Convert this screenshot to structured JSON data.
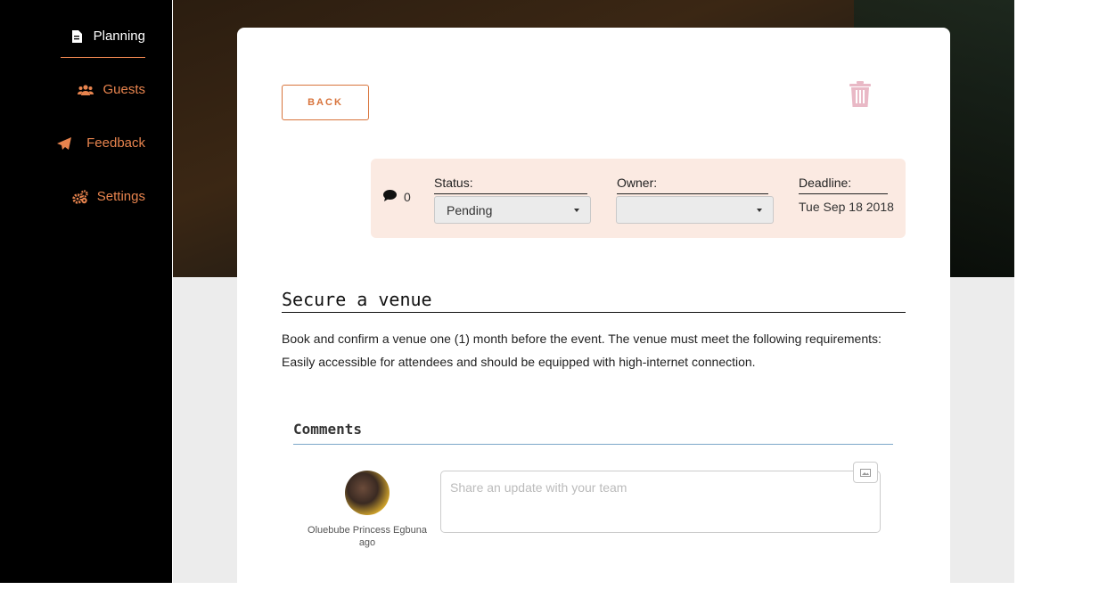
{
  "sidebar": {
    "items": [
      {
        "label": "Planning",
        "icon": "document-icon"
      },
      {
        "label": "Guests",
        "icon": "users-icon"
      },
      {
        "label": "Feedback",
        "icon": "paper-plane-icon"
      },
      {
        "label": "Settings",
        "icon": "gears-icon"
      }
    ],
    "active": "Planning"
  },
  "task": {
    "back_label": "BACK",
    "comment_count": "0",
    "status_label": "Status:",
    "status_value": "Pending",
    "owner_label": "Owner:",
    "owner_value": "",
    "deadline_label": "Deadline:",
    "deadline_value": "Tue Sep 18 2018",
    "title": "Secure a venue",
    "description": "Book and confirm a venue one (1) month before the event. The venue must meet the following requirements: Easily accessible for attendees and should be equipped with high-internet connection."
  },
  "comments": {
    "title": "Comments",
    "author_name": "Oluebube Princess Egbuna",
    "author_time": "ago",
    "input_placeholder": "Share an update with your team"
  },
  "colors": {
    "accent": "#e8844e",
    "meta_bg": "#fbeae2",
    "sidebar_bg": "#000000"
  }
}
